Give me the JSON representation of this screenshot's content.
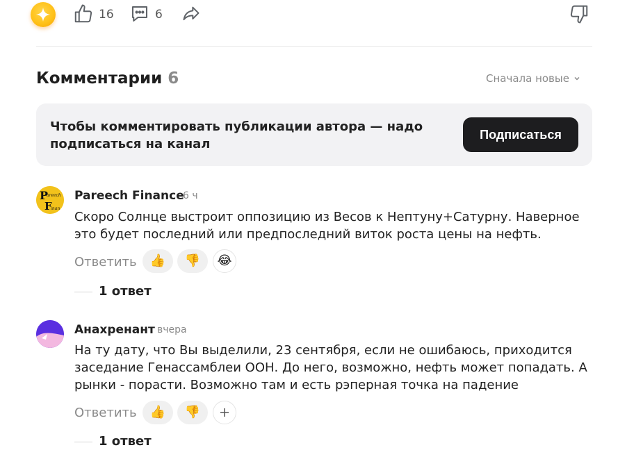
{
  "actions": {
    "likes": "16",
    "comments": "6"
  },
  "comments_header": {
    "title": "Комментарии",
    "count": "6",
    "sort_label": "Сначала новые"
  },
  "subscribe_banner": {
    "text": "Чтобы комментировать публикации автора — надо подписаться на канал",
    "button_label": "Подписаться"
  },
  "comments": [
    {
      "author": "Pareech Finance",
      "time": "6 ч",
      "avatar_text": "Pareech Finance",
      "text": "Скоро Солнце выстроит оппозицию из Весов к Нептуну+Сатурну. Наверное это будет последний или предпоследний виток роста цены на нефть.",
      "reply_label": "Ответить",
      "replies": "1 ответ"
    },
    {
      "author": "Анахренант",
      "time": "вчера",
      "text": "На ту дату, что Вы выделили, 23 сентября, если не ошибаюсь, приходится заседание Генассамблеи ООН. До него, возможно, нефть может попадать. А рынки - порасти. Возможно там и есть рэперная точка на падение",
      "reply_label": "Ответить",
      "replies": "1 ответ"
    }
  ],
  "colors": {
    "accent_star": "#ffc21a",
    "button_dark": "#1d1d1f",
    "banner_bg": "#f2f2f4",
    "muted_text": "#8a8a8a"
  }
}
